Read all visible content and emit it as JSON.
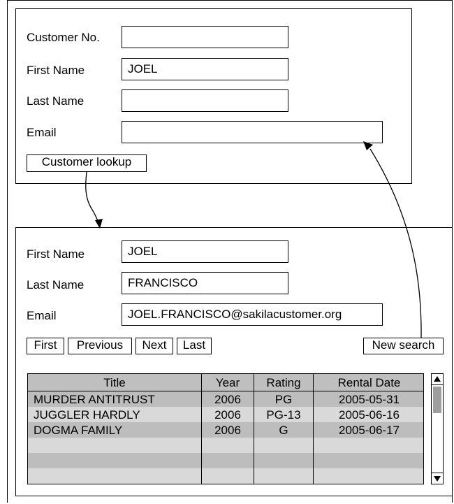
{
  "lookup_form": {
    "customer_no_label": "Customer No.",
    "customer_no_value": "",
    "first_name_label": "First Name",
    "first_name_value": "JOEL",
    "last_name_label": "Last Name",
    "last_name_value": "",
    "email_label": "Email",
    "email_value": "",
    "lookup_button": "Customer lookup"
  },
  "result_form": {
    "first_name_label": "First Name",
    "first_name_value": "JOEL",
    "last_name_label": "Last Name",
    "last_name_value": "FRANCISCO",
    "email_label": "Email",
    "email_value": "JOEL.FRANCISCO@sakilacustomer.org",
    "nav": {
      "first": "First",
      "previous": "Previous",
      "next": "Next",
      "last": "Last"
    },
    "new_search_button": "New search"
  },
  "rentals": {
    "columns": [
      "Title",
      "Year",
      "Rating",
      "Rental Date"
    ],
    "rows": [
      [
        "MURDER ANTITRUST",
        "2006",
        "PG",
        "2005-05-31"
      ],
      [
        "JUGGLER HARDLY",
        "2006",
        "PG-13",
        "2005-06-16"
      ],
      [
        "DOGMA FAMILY",
        "2006",
        "G",
        "2005-06-17"
      ],
      [
        "",
        "",
        "",
        ""
      ],
      [
        "",
        "",
        "",
        ""
      ],
      [
        "",
        "",
        "",
        ""
      ]
    ],
    "sort_icon": "sort-updown-icon"
  }
}
